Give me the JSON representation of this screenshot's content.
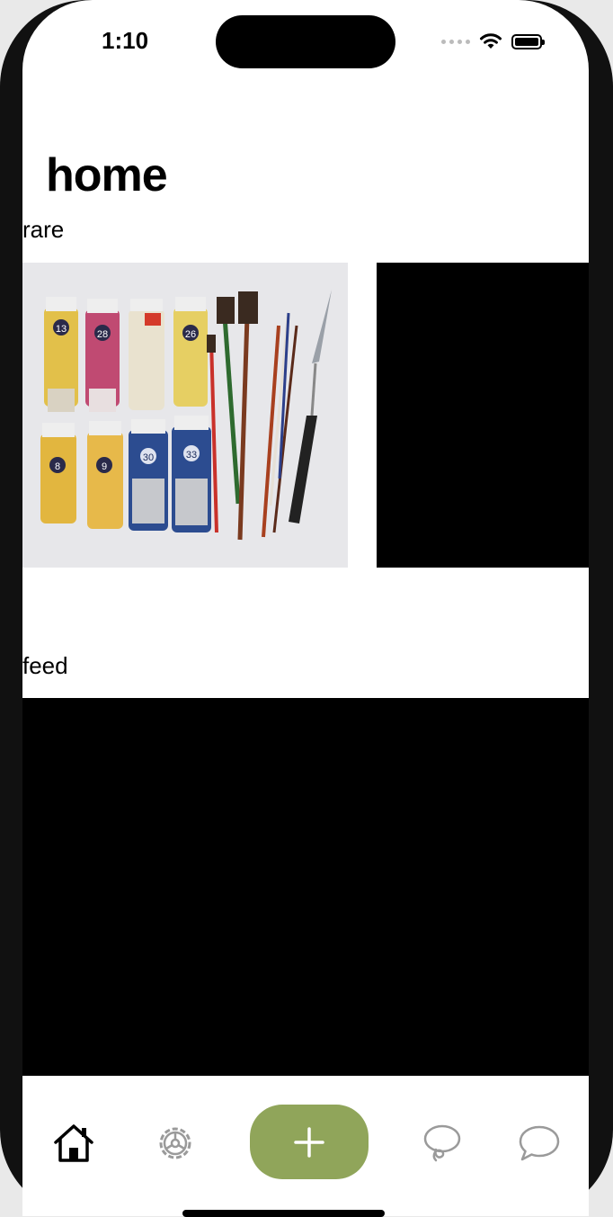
{
  "status": {
    "time": "1:10"
  },
  "page": {
    "title": "home"
  },
  "sections": {
    "rare": "rare",
    "feed": "feed"
  },
  "images": {
    "paint_photo": "paint-tubes-and-brushes",
    "tube_numbers": [
      "13",
      "28",
      "26",
      "8",
      "9",
      "30",
      "33"
    ]
  },
  "tabs": {
    "home": "home-icon",
    "settings": "gear-icon",
    "add": "plus-icon",
    "lasso": "lasso-icon",
    "chat": "chat-bubble-icon"
  },
  "colors": {
    "accent": "#90a55a",
    "inactive_icon": "#9a9a9a"
  }
}
